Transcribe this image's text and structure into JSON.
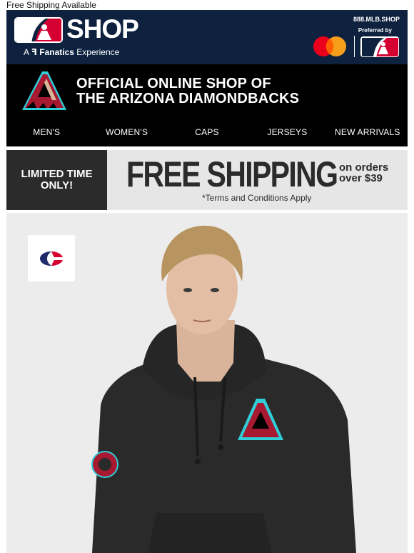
{
  "preheader": "Free Shipping Available",
  "header": {
    "shop_label": "SHOP",
    "fanatics_prefix": "A",
    "fanatics_brand": "Fanatics",
    "fanatics_suffix": "Experience",
    "phone": "888.MLB.SHOP",
    "preferred_by": "Preferred by",
    "bg_color": "#0e2240"
  },
  "team_banner": {
    "line1": "OFFICIAL ONLINE SHOP OF",
    "line2": "THE ARIZONA DIAMONDBACKS",
    "brand_color": "#a71930",
    "accent_color": "#30ced8"
  },
  "nav": {
    "items": [
      "MEN'S",
      "WOMEN'S",
      "CAPS",
      "JERSEYS",
      "NEW ARRIVALS"
    ]
  },
  "promo": {
    "limited_line1": "LIMITED TIME",
    "limited_line2": "ONLY!",
    "headline": "FREE SHIPPING",
    "on_orders_line1": "on orders",
    "on_orders_line2": "over $39",
    "terms": "*Terms and Conditions Apply"
  },
  "hero": {
    "brand_badge": "champion-logo-icon",
    "product": "hoodie-model-photo"
  }
}
